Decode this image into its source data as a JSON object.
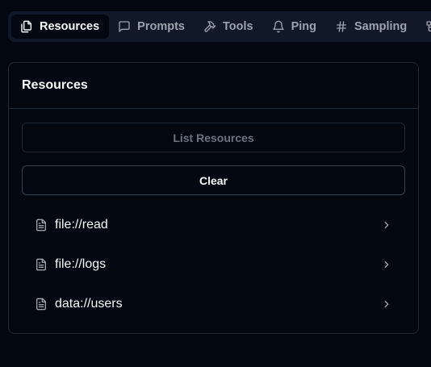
{
  "tabs": [
    {
      "label": "Resources",
      "icon": "files-icon",
      "active": true
    },
    {
      "label": "Prompts",
      "icon": "message-square-icon",
      "active": false
    },
    {
      "label": "Tools",
      "icon": "hammer-icon",
      "active": false
    },
    {
      "label": "Ping",
      "icon": "bell-icon",
      "active": false
    },
    {
      "label": "Sampling",
      "icon": "hash-icon",
      "active": false
    },
    {
      "label": "",
      "icon": "list-tree-icon",
      "active": false
    }
  ],
  "panel": {
    "title": "Resources",
    "list_button_label": "List Resources",
    "clear_button_label": "Clear",
    "resources": [
      {
        "name": "file://read",
        "icon": "file-text-icon"
      },
      {
        "name": "file://logs",
        "icon": "file-text-icon"
      },
      {
        "name": "data://users",
        "icon": "file-text-icon"
      }
    ]
  },
  "colors": {
    "background": "#030712",
    "tabbar": "#111827",
    "border": "#1f2937",
    "muted_text": "#9ca3af",
    "text": "#f9fafb"
  }
}
